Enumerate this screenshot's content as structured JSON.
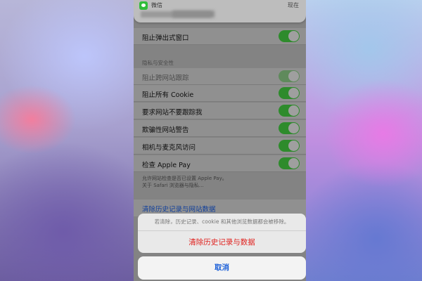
{
  "notification": {
    "app_name": "微信",
    "time": "现在",
    "icon": "wechat-icon"
  },
  "settings": {
    "block_popups": {
      "label": "阻止弹出式窗口",
      "on": true
    },
    "privacy_header": "隐私与安全性",
    "rows": [
      {
        "label": "阻止跨网站跟踪",
        "on": true,
        "disabled": true
      },
      {
        "label": "阻止所有 Cookie",
        "on": true,
        "disabled": false
      },
      {
        "label": "要求网站不要跟踪我",
        "on": true,
        "disabled": false
      },
      {
        "label": "欺骗性网站警告",
        "on": true,
        "disabled": false
      },
      {
        "label": "相机与麦克风访问",
        "on": true,
        "disabled": false
      },
      {
        "label": "检查 Apple Pay",
        "on": true,
        "disabled": false
      }
    ],
    "footer_line1": "允许网站检查是否已设置 Apple Pay。",
    "footer_line2": "关于 Safari 浏览器与隐私…",
    "clear_link": "清除历史记录与网站数据"
  },
  "action_sheet": {
    "message": "若清除，历史记录、cookie 和其他浏览数据都会被移除。",
    "destructive_label": "清除历史记录与数据",
    "cancel_label": "取消"
  },
  "colors": {
    "toggle_on": "#34c759",
    "destructive": "#ff3b30",
    "link": "#007aff"
  }
}
